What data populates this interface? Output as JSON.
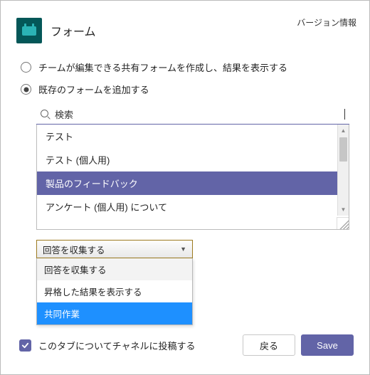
{
  "header": {
    "app_title": "フォーム",
    "version_link": "バージョン情報"
  },
  "options": {
    "create_label": "チームが編集できる共有フォームを作成し、結果を表示する",
    "add_existing_label": "既存のフォームを追加する",
    "selected": "add_existing"
  },
  "search": {
    "placeholder": "検索",
    "value": "検索"
  },
  "forms_list": {
    "items": [
      {
        "label": "テスト"
      },
      {
        "label": "テスト (個人用)"
      },
      {
        "label": "製品のフィードバック",
        "highlighted": true
      },
      {
        "label": "アンケート (個人用) について"
      }
    ]
  },
  "action_select": {
    "selected_label": "回答を収集する",
    "options": [
      {
        "label": "回答を収集する"
      },
      {
        "label": "昇格した結果を表示する"
      },
      {
        "label": "共同作業",
        "highlighted": true
      }
    ]
  },
  "footer": {
    "post_to_channel_label": "このタブについてチャネルに投稿する",
    "post_to_channel_checked": true,
    "back_button": "戻る",
    "save_button": "Save"
  },
  "colors": {
    "accent": "#6264a7",
    "highlight_blue": "#1e90ff",
    "icon_teal": "#045758"
  }
}
